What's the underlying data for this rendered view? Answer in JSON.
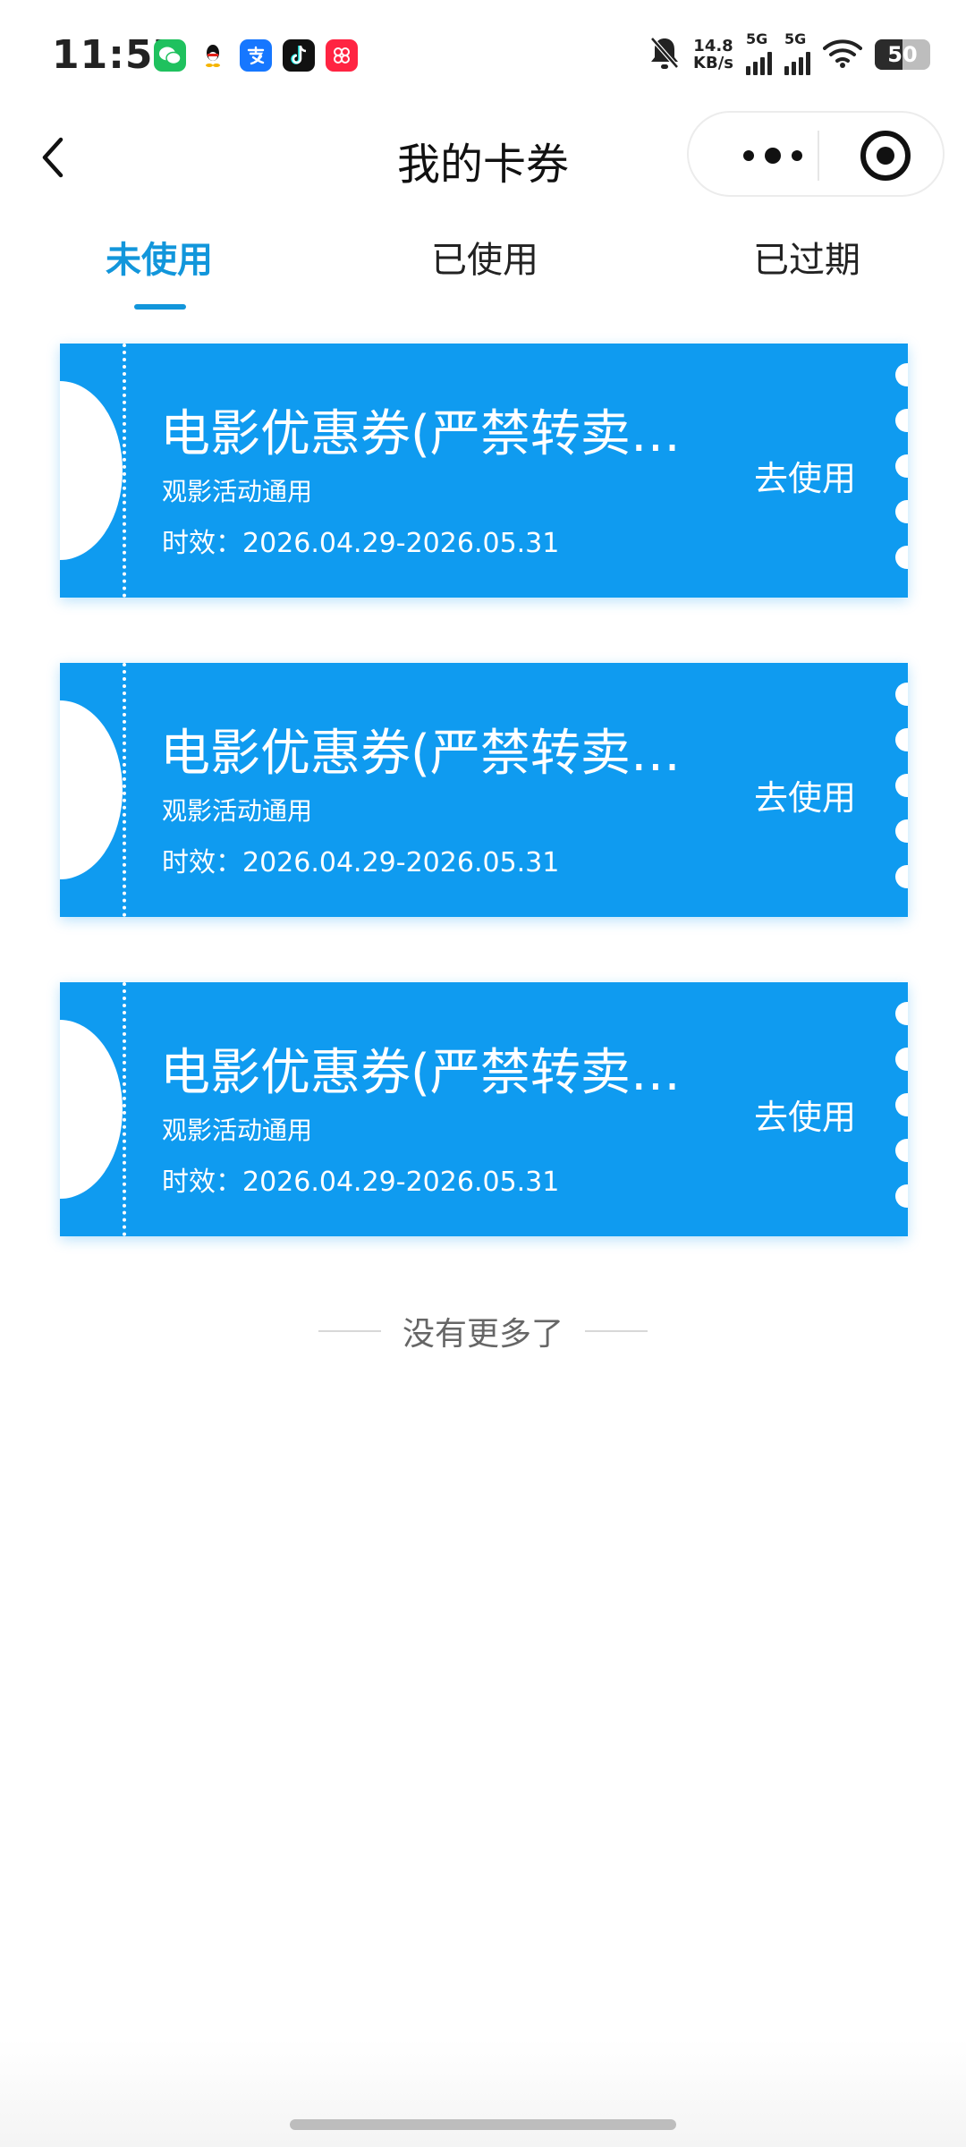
{
  "status_bar": {
    "time": "11:57",
    "speed_value": "14.8",
    "speed_unit": "KB/s",
    "signal1_label": "5G",
    "signal2_label": "5G",
    "battery": "50",
    "app_icons": [
      "wechat-icon",
      "qq-icon",
      "alipay-icon",
      "douyin-icon",
      "xiaohongshu-icon"
    ]
  },
  "nav": {
    "title": "我的卡券",
    "back_icon": "chevron-left-icon",
    "more_icon": "more-dots-icon",
    "close_icon": "target-circle-icon"
  },
  "tabs": [
    {
      "label": "未使用",
      "active": true
    },
    {
      "label": "已使用",
      "active": false
    },
    {
      "label": "已过期",
      "active": false
    }
  ],
  "coupons": [
    {
      "name": "电影优惠券(严禁转卖…",
      "desc": "观影活动通用",
      "validity": "时效：2026.04.29-2026.05.31",
      "action": "去使用"
    },
    {
      "name": "电影优惠券(严禁转卖…",
      "desc": "观影活动通用",
      "validity": "时效：2026.04.29-2026.05.31",
      "action": "去使用"
    },
    {
      "name": "电影优惠券(严禁转卖…",
      "desc": "观影活动通用",
      "validity": "时效：2026.04.29-2026.05.31",
      "action": "去使用"
    }
  ],
  "footer": {
    "no_more": "没有更多了"
  },
  "colors": {
    "accent": "#1296db",
    "coupon_bg": "#0f9bf0"
  }
}
